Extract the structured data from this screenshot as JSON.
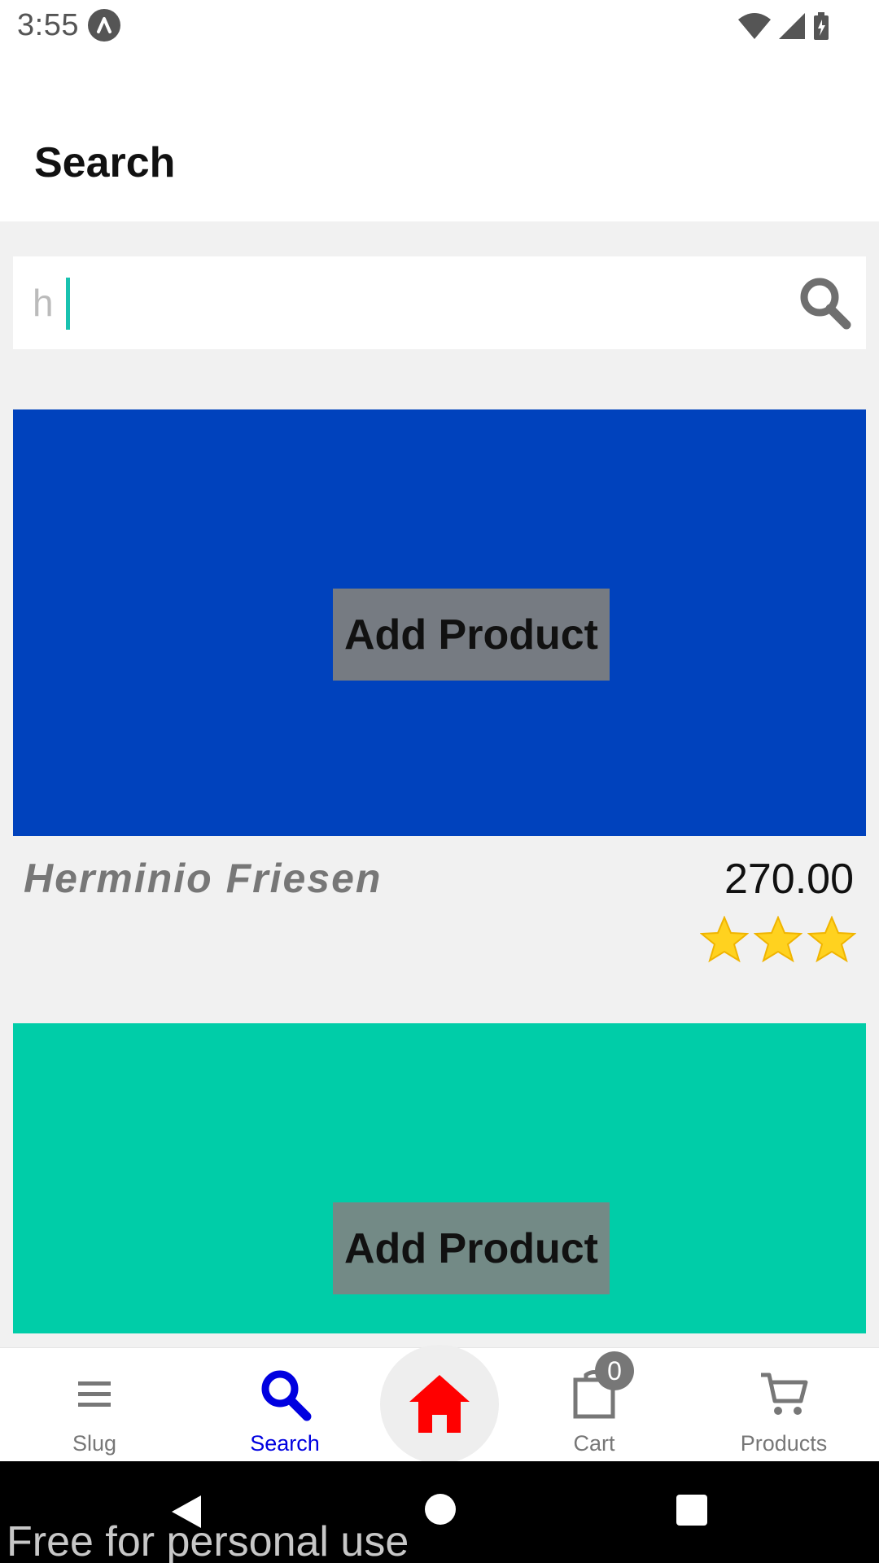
{
  "status_bar": {
    "time": "3:55"
  },
  "header": {
    "title": "Search"
  },
  "search": {
    "value": "h",
    "icon": "search-icon"
  },
  "products": [
    {
      "image_color": "#0042bd",
      "button_label": "Add Product",
      "name": "Herminio Friesen",
      "price": "270.00",
      "rating": 3
    },
    {
      "image_color": "#00cda8",
      "button_label": "Add Product"
    }
  ],
  "bottom_nav": {
    "items": [
      {
        "label": "Slug",
        "icon": "menu-icon",
        "active": false
      },
      {
        "label": "Search",
        "icon": "search-icon",
        "active": true
      },
      {
        "label": "Home",
        "icon": "home-icon",
        "active": false
      },
      {
        "label": "Cart",
        "icon": "shopping-bag-icon",
        "active": false,
        "badge": "0"
      },
      {
        "label": "Products",
        "icon": "cart-icon",
        "active": false
      }
    ]
  },
  "watermark": "Free for personal use",
  "colors": {
    "active": "#0000e0",
    "home": "#ff0000",
    "product_1": "#0042bd",
    "product_2": "#00cda8"
  }
}
